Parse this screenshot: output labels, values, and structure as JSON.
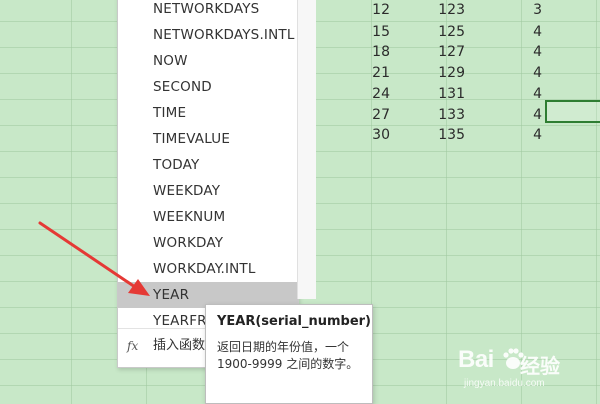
{
  "sheet": {
    "rows": [
      [
        "12",
        "123",
        "3"
      ],
      [
        "15",
        "125",
        "4"
      ],
      [
        "18",
        "127",
        "4"
      ],
      [
        "21",
        "129",
        "4"
      ],
      [
        "24",
        "131",
        "4"
      ],
      [
        "27",
        "133",
        "4"
      ],
      [
        "30",
        "135",
        "4"
      ]
    ]
  },
  "function_list": {
    "items": [
      "NETWORKDAYS",
      "NETWORKDAYS.INTL",
      "NOW",
      "SECOND",
      "TIME",
      "TIMEVALUE",
      "TODAY",
      "WEEKDAY",
      "WEEKNUM",
      "WORKDAY",
      "WORKDAY.INTL",
      "YEAR",
      "YEARFRA"
    ],
    "selected": "YEAR",
    "insert_icon": "fx",
    "insert_label": "插入函数"
  },
  "tooltip": {
    "title": "YEAR(serial_number)",
    "description": "返回日期的年份值，一个 1900-9999 之间的数字。"
  },
  "annotation": {
    "arrow_color": "#e53935"
  },
  "watermark": {
    "brand_part1": "Bai",
    "brand_part2": "经验",
    "url": "jingyan.baidu.com"
  }
}
